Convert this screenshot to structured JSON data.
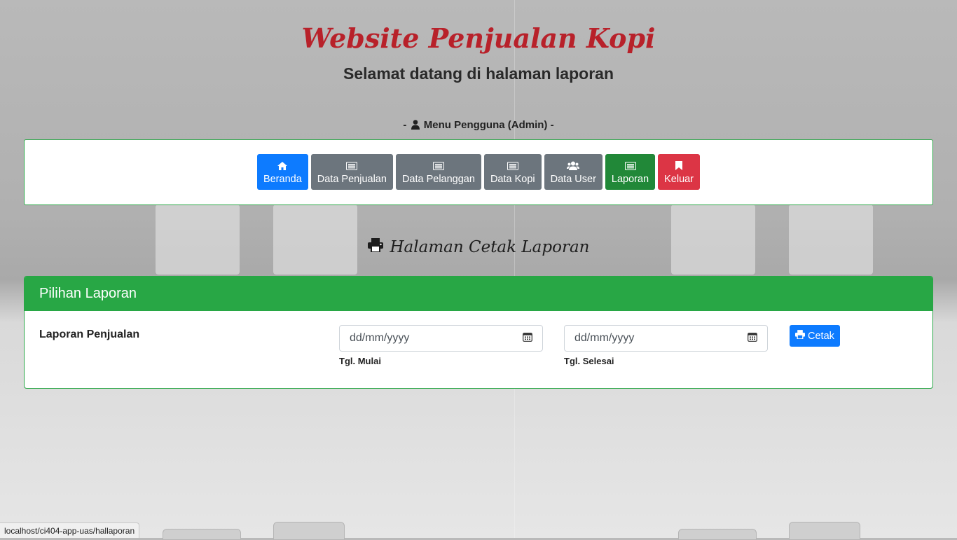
{
  "header": {
    "title": "Website Penjualan Kopi",
    "subtitle": "Selamat datang di halaman laporan"
  },
  "menu": {
    "caption": "-  Menu Pengguna (Admin) -",
    "caption_icon": "user-icon",
    "items": [
      {
        "label": "Beranda",
        "icon": "home-icon",
        "color": "#0d7bff"
      },
      {
        "label": "Data Penjualan",
        "icon": "list-icon",
        "color": "#6c757d"
      },
      {
        "label": "Data Pelanggan",
        "icon": "list-icon",
        "color": "#6c757d"
      },
      {
        "label": "Data Kopi",
        "icon": "list-icon",
        "color": "#6c757d"
      },
      {
        "label": "Data User",
        "icon": "users-icon",
        "color": "#6c757d"
      },
      {
        "label": "Laporan",
        "icon": "list-icon",
        "color": "#218838"
      },
      {
        "label": "Keluar",
        "icon": "bookmark-icon",
        "color": "#dc3545"
      }
    ]
  },
  "page": {
    "heading": "Halaman Cetak Laporan",
    "heading_icon": "print-icon"
  },
  "report_card": {
    "header": "Pilihan Laporan",
    "row_label": "Laporan Penjualan",
    "start_date": {
      "placeholder": "dd/mm/yyyy",
      "hint": "Tgl. Mulai"
    },
    "end_date": {
      "placeholder": "dd/mm/yyyy",
      "hint": "Tgl. Selesai"
    },
    "print_button": "Cetak"
  },
  "status_bar": {
    "url": "localhost/ci404-app-uas/hallaporan"
  },
  "colors": {
    "accent_green": "#28a745",
    "primary_blue": "#0d7bff",
    "title_red": "#b8212a"
  }
}
